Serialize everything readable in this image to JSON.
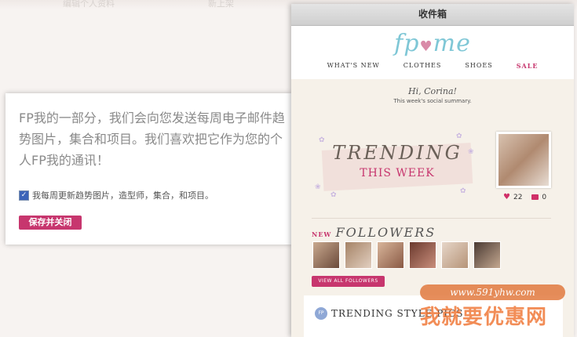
{
  "background": {
    "faded_texts": [
      "编辑个人资料",
      "新上架"
    ]
  },
  "signup_card": {
    "description": "FP我的一部分，我们会向您发送每周电子邮件趋势图片，集合和项目。我们喜欢把它作为您的个人FP我的通讯！",
    "checkbox_label": "我每周更新趋势图片，造型师，集合，和项目。",
    "checkbox_checked": true,
    "save_button": "保存并关闭"
  },
  "inbox": {
    "title": "收件箱",
    "logo_text": "fp",
    "logo_text_2": "me",
    "nav": [
      "WHAT'S NEW",
      "CLOTHES",
      "SHOES",
      "SALE"
    ],
    "greeting": "Hi, Corina!",
    "summary": "This week's social summary.",
    "trending_title": "TRENDING",
    "trending_subtitle": "THIS WEEK",
    "likes": "22",
    "comments": "0",
    "followers_new": "NEW",
    "followers_title": "FOLLOWERS",
    "view_all_button": "VIEW ALL FOLLOWERS",
    "style_pics_title": "TRENDING STYLE PICS",
    "style_icon_label": "FP"
  },
  "watermark": {
    "url": "www.591yhw.com",
    "text": "我就要优惠网"
  },
  "colors": {
    "accent": "#c7366e",
    "logo": "#7fc7d6",
    "watermark": "#f07a3a"
  }
}
